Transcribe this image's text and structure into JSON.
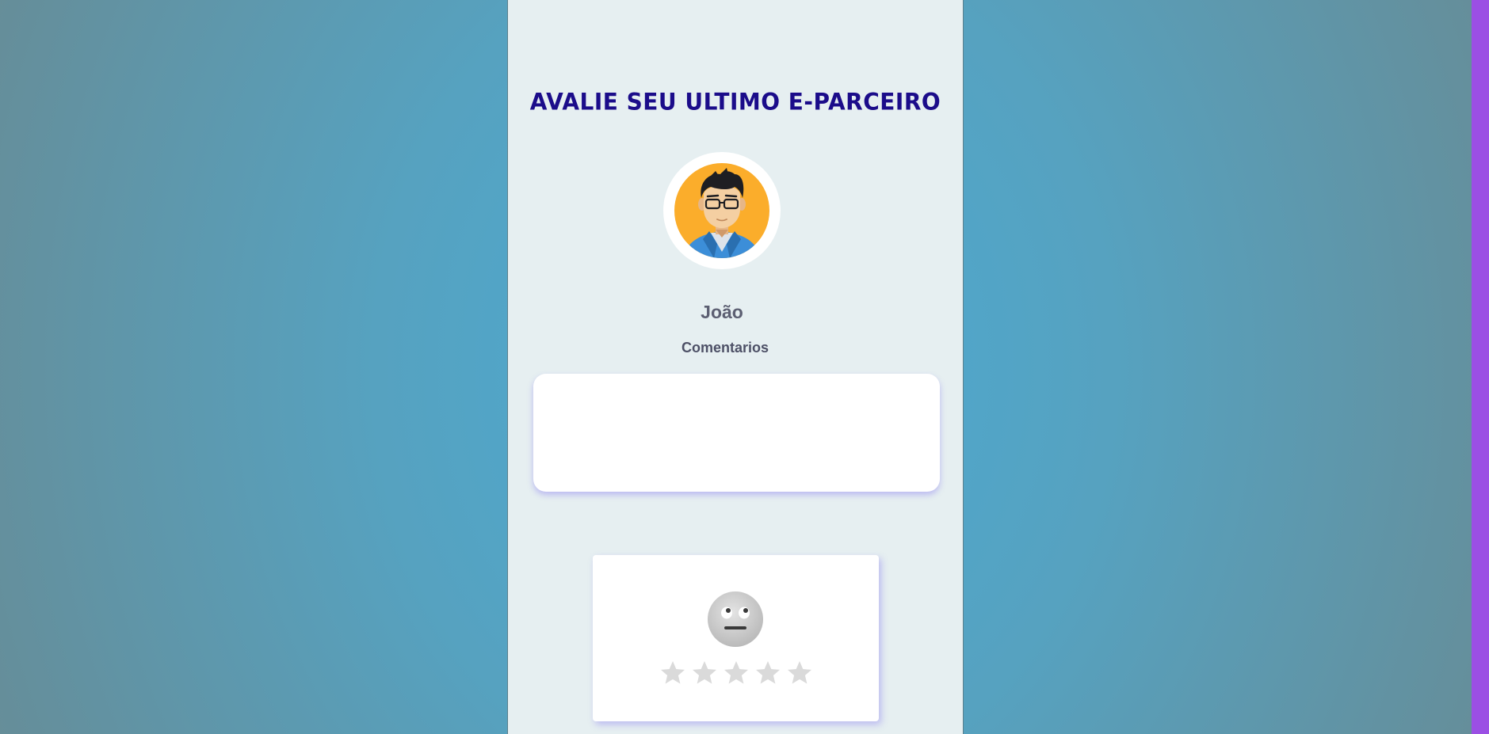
{
  "page": {
    "title": "AVALIE SEU ULTIMO E-PARCEIRO"
  },
  "partner": {
    "name": "João",
    "avatar_icon": "man-with-glasses-avatar-icon"
  },
  "comments": {
    "label": "Comentarios",
    "value": "",
    "placeholder": ""
  },
  "rating": {
    "emoji_icon": "neutral-face-icon",
    "stars": [
      {
        "icon": "star-icon",
        "filled": false
      },
      {
        "icon": "star-icon",
        "filled": false
      },
      {
        "icon": "star-icon",
        "filled": false
      },
      {
        "icon": "star-icon",
        "filled": false
      },
      {
        "icon": "star-icon",
        "filled": false
      }
    ],
    "value": 0,
    "max": 5
  },
  "colors": {
    "title": "#1b0c8a",
    "accent_strip": "#9b4fe4",
    "star_empty": "#dadada",
    "avatar_bg": "#fbad2b"
  }
}
